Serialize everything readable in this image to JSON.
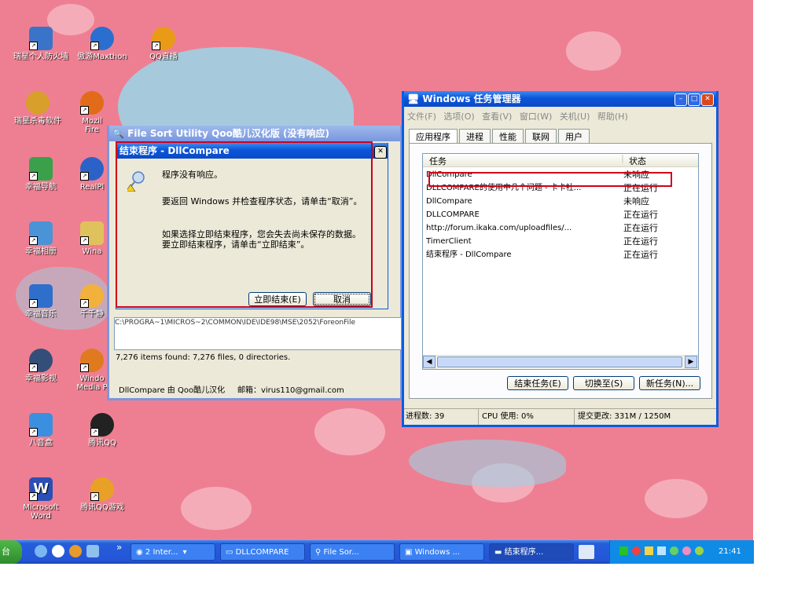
{
  "desktop_icons": [
    {
      "label": "瑞星个人防火墙",
      "icon": "firewall-icon",
      "color": "#3a74c9"
    },
    {
      "label": "傲游Maxthon",
      "icon": "maxthon-icon",
      "color": "#2a6fd0"
    },
    {
      "label": "QQ直播",
      "icon": "qq-live-icon",
      "color": "#e99b17"
    },
    {
      "label": "瑞星杀毒软件",
      "icon": "antivirus-icon",
      "color": "#d8a02a"
    },
    {
      "label": "Mozil Fire",
      "icon": "firefox-icon",
      "color": "#e26b1a"
    },
    {
      "label": "幸福导航",
      "icon": "nav-icon",
      "color": "#3aa14a"
    },
    {
      "label": "RealPl",
      "icon": "realplayer-icon",
      "color": "#2c62c7"
    },
    {
      "label": "幸福相册",
      "icon": "album-icon",
      "color": "#4a93d6"
    },
    {
      "label": "Wina",
      "icon": "winamp-icon",
      "color": "#e0c25c"
    },
    {
      "label": "幸福音乐",
      "icon": "music-icon",
      "color": "#2e6fcb"
    },
    {
      "label": "千千静",
      "icon": "ttplayer-icon",
      "color": "#f2b13b"
    },
    {
      "label": "幸福影视",
      "icon": "video-icon",
      "color": "#334e78"
    },
    {
      "label": "Windo Media P",
      "icon": "wmp-icon",
      "color": "#e07a1f"
    },
    {
      "label": "八音盒",
      "icon": "musicbox-icon",
      "color": "#3b8fe0"
    },
    {
      "label": "腾讯QQ",
      "icon": "qq-icon",
      "color": "#222222"
    },
    {
      "label": "Microsoft Word",
      "icon": "word-icon",
      "color": "#2b4fb5"
    },
    {
      "label": "腾讯QQ游戏",
      "icon": "qqgame-icon",
      "color": "#e8a126"
    }
  ],
  "fsu": {
    "title": "File Sort Utility Qoo酷儿汉化版 (没有响应)",
    "path_text": "C:\\PROGRA~1\\MICROS~2\\COMMON\\IDE\\IDE98\\MSE\\2052\\ForeonFile",
    "items_found": "7,276 items found:  7,276 files, 0 directories.",
    "footer": "DllCompare 由 Qoo酷儿汉化     邮箱：virus110@gmail.com"
  },
  "end_dialog": {
    "title": "结束程序 - DllCompare",
    "close": "✕",
    "line1": "程序没有响应。",
    "line2": "要返回 Windows 并检查程序状态，请单击“取消”。",
    "line3": "如果选择立即结束程序，您会失去尚未保存的数据。要立即结束程序，请单击“立即结束”。",
    "end_now": "立即结束(E)",
    "cancel": "取消"
  },
  "taskmgr": {
    "title": "Windows 任务管理器",
    "menu": [
      "文件(F)",
      "选项(O)",
      "查看(V)",
      "窗口(W)",
      "关机(U)",
      "帮助(H)"
    ],
    "tabs": [
      "应用程序",
      "进程",
      "性能",
      "联网",
      "用户"
    ],
    "col_task": "任务",
    "col_status": "状态",
    "rows": [
      {
        "name": "DllCompare",
        "status": "未响应"
      },
      {
        "name": "DLLCOMPARE的使用中几个问题 - 卡卡社...",
        "status": "正在运行"
      },
      {
        "name": "DllCompare",
        "status": "未响应"
      },
      {
        "name": "DLLCOMPARE",
        "status": "正在运行"
      },
      {
        "name": "http://forum.ikaka.com/uploadfiles/...",
        "status": "正在运行"
      },
      {
        "name": "TimerClient",
        "status": "正在运行"
      },
      {
        "name": "结束程序 - DllCompare",
        "status": "正在运行"
      }
    ],
    "end_task": "结束任务(E)",
    "switch_to": "切换至(S)",
    "new_task": "新任务(N)...",
    "status_procs": "进程数: 39",
    "status_cpu": "CPU 使用: 0%",
    "status_commit": "提交更改: 331M / 1250M"
  },
  "taskbar": {
    "start_fragment": "台",
    "quicklaunch_more": "»",
    "items": [
      "2 Inter...",
      "DLLCOMPARE",
      "File Sor...",
      "Windows ...",
      "结束程序..."
    ],
    "clock": "21:41"
  }
}
